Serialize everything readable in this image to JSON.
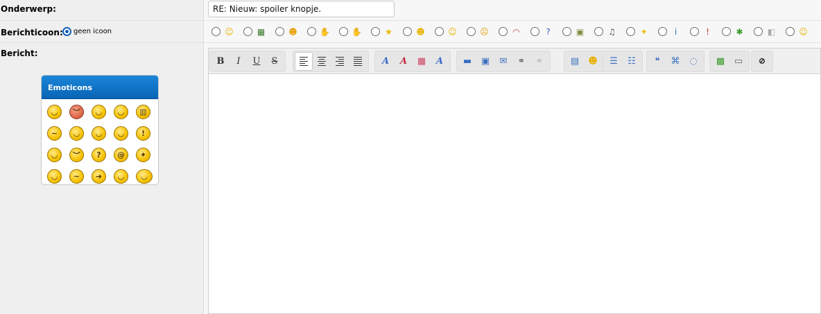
{
  "subject": {
    "label": "Onderwerp:",
    "value": "RE: Nieuw: spoiler knopje."
  },
  "post_icon": {
    "label": "Berichticoon:",
    "no_icon_label": "geen icoon",
    "icons": [
      {
        "name": "smile-icon",
        "glyph": "☺",
        "color": "#e8b400"
      },
      {
        "name": "film-icon",
        "glyph": "▦",
        "color": "#3a7a2a"
      },
      {
        "name": "wink-icon",
        "glyph": "☻",
        "color": "#e8a000"
      },
      {
        "name": "thumbs-up-icon",
        "glyph": "✋",
        "color": "#f0a0a0"
      },
      {
        "name": "thumbs-down-icon",
        "glyph": "✋",
        "color": "#f0a0a0"
      },
      {
        "name": "star-icon",
        "glyph": "★",
        "color": "#e8b800"
      },
      {
        "name": "happy-icon",
        "glyph": "☻",
        "color": "#e8b400"
      },
      {
        "name": "surprised-icon",
        "glyph": "☺",
        "color": "#e8b400"
      },
      {
        "name": "angry-icon",
        "glyph": "☹",
        "color": "#e0a000"
      },
      {
        "name": "rainbow-icon",
        "glyph": "◠",
        "color": "#d04040"
      },
      {
        "name": "question-icon",
        "glyph": "?",
        "color": "#4060c0"
      },
      {
        "name": "picture-icon",
        "glyph": "▣",
        "color": "#7a8a3a"
      },
      {
        "name": "music-note-icon",
        "glyph": "♫",
        "color": "#555555"
      },
      {
        "name": "lightbulb-icon",
        "glyph": "✦",
        "color": "#e8c000"
      },
      {
        "name": "info-icon",
        "glyph": "i",
        "color": "#3070c0"
      },
      {
        "name": "exclamation-icon",
        "glyph": "!",
        "color": "#d03030"
      },
      {
        "name": "bug-icon",
        "glyph": "✱",
        "color": "#3a9a2a"
      },
      {
        "name": "package-icon",
        "glyph": "◧",
        "color": "#aaaaaa"
      },
      {
        "name": "grin-icon",
        "glyph": "☺",
        "color": "#e8b400"
      }
    ]
  },
  "message": {
    "label": "Bericht:",
    "emoticons_title": "Emoticons",
    "emoticons": [
      {
        "name": "smile-emoticon",
        "glyph": "◡",
        "variant": ""
      },
      {
        "name": "mad-emoticon",
        "glyph": "︶",
        "variant": "red"
      },
      {
        "name": "cool-emoticon",
        "glyph": "◡",
        "variant": ""
      },
      {
        "name": "wink-emoticon",
        "glyph": "◡",
        "variant": ""
      },
      {
        "name": "big-grin-emoticon",
        "glyph": "▥",
        "variant": ""
      },
      {
        "name": "confused-emoticon",
        "glyph": "~",
        "variant": ""
      },
      {
        "name": "tongue-emoticon",
        "glyph": "◡",
        "variant": ""
      },
      {
        "name": "shades-emoticon",
        "glyph": "◡",
        "variant": ""
      },
      {
        "name": "rolleyes-emoticon",
        "glyph": "◡",
        "variant": ""
      },
      {
        "name": "exclamation-emoticon",
        "glyph": "!",
        "variant": ""
      },
      {
        "name": "eek-emoticon",
        "glyph": "◡",
        "variant": ""
      },
      {
        "name": "frown-emoticon",
        "glyph": "︶",
        "variant": ""
      },
      {
        "name": "huh-emoticon",
        "glyph": "?",
        "variant": ""
      },
      {
        "name": "at-emoticon",
        "glyph": "@",
        "variant": ""
      },
      {
        "name": "idea-emoticon",
        "glyph": "✦",
        "variant": ""
      },
      {
        "name": "sleepy-emoticon",
        "glyph": "◡",
        "variant": ""
      },
      {
        "name": "doubt-emoticon",
        "glyph": "~",
        "variant": ""
      },
      {
        "name": "arrow-emoticon",
        "glyph": "➜",
        "variant": ""
      },
      {
        "name": "laugh-emoticon",
        "glyph": "◡",
        "variant": ""
      },
      {
        "name": "angel-emoticon",
        "glyph": "◡",
        "variant": "wing"
      }
    ],
    "body": ""
  },
  "toolbar": {
    "groups": [
      [
        {
          "name": "bold-button",
          "glyph": "B",
          "style": "bold"
        },
        {
          "name": "italic-button",
          "glyph": "I",
          "style": "italic"
        },
        {
          "name": "underline-button",
          "glyph": "U",
          "style": "underline"
        },
        {
          "name": "strikethrough-button",
          "glyph": "S",
          "style": "strike"
        }
      ],
      [
        {
          "name": "align-left-button",
          "glyph": "bars-left",
          "style": "sel"
        },
        {
          "name": "align-center-button",
          "glyph": "bars-center",
          "style": ""
        },
        {
          "name": "align-right-button",
          "glyph": "bars-right",
          "style": ""
        },
        {
          "name": "justify-button",
          "glyph": "bars-full",
          "style": ""
        }
      ],
      [
        {
          "name": "font-button",
          "glyph": "A",
          "style": "fontA"
        },
        {
          "name": "font-size-button",
          "glyph": "A",
          "style": "fontRed"
        },
        {
          "name": "color-button",
          "glyph": "▦",
          "style": "color"
        },
        {
          "name": "clear-format-button",
          "glyph": "A",
          "style": "fontA"
        }
      ],
      [
        {
          "name": "horizontal-rule-button",
          "glyph": "▬",
          "style": "blue"
        },
        {
          "name": "insert-image-button",
          "glyph": "▣",
          "style": "blue"
        },
        {
          "name": "insert-email-button",
          "glyph": "✉",
          "style": "blue"
        },
        {
          "name": "insert-link-button",
          "glyph": "⚭",
          "style": "grey"
        },
        {
          "name": "unlink-button",
          "glyph": "⚭",
          "style": "light"
        }
      ],
      [
        {
          "name": "insert-video-button",
          "glyph": "▤",
          "style": "blue"
        },
        {
          "name": "insert-smiley-button",
          "glyph": "☻",
          "style": "yellow"
        }
      ],
      [
        {
          "name": "bullet-list-button",
          "glyph": "☰",
          "style": "blue"
        },
        {
          "name": "numbered-list-button",
          "glyph": "☷",
          "style": "blue"
        }
      ],
      [
        {
          "name": "quote-button",
          "glyph": "❝",
          "style": "blue"
        },
        {
          "name": "code-button",
          "glyph": "⌘",
          "style": "blue"
        },
        {
          "name": "spoiler-bubble-button",
          "glyph": "◌",
          "style": "blue"
        }
      ],
      [
        {
          "name": "source-mode-button",
          "glyph": "▩",
          "style": "green"
        },
        {
          "name": "preview-button",
          "glyph": "▭",
          "style": "grey"
        }
      ],
      [
        {
          "name": "spoiler-hide-button",
          "glyph": "⊘",
          "style": "bold"
        }
      ]
    ]
  }
}
